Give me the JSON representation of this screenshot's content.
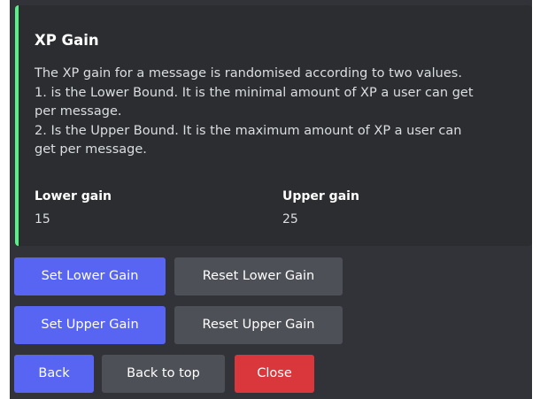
{
  "embed": {
    "accent_color": "#57f287",
    "title": "XP Gain",
    "description_lines": [
      "The XP gain for a message is randomised according to two values.",
      "1. is the Lower Bound. It is the minimal amount of XP a user can get",
      "per message.",
      "2. Is the Upper Bound. It is the maximum amount of XP a user can",
      "get per message."
    ],
    "fields": {
      "lower": {
        "name": "Lower gain",
        "value": "15"
      },
      "upper": {
        "name": "Upper gain",
        "value": "25"
      }
    }
  },
  "buttons": {
    "set_lower": {
      "label": "Set Lower Gain",
      "style": "primary"
    },
    "reset_lower": {
      "label": "Reset Lower Gain",
      "style": "secondary"
    },
    "set_upper": {
      "label": "Set Upper Gain",
      "style": "primary"
    },
    "reset_upper": {
      "label": "Reset Upper Gain",
      "style": "secondary"
    },
    "back": {
      "label": "Back",
      "style": "primary"
    },
    "back_to_top": {
      "label": "Back to top",
      "style": "secondary"
    },
    "close": {
      "label": "Close",
      "style": "danger"
    }
  },
  "colors": {
    "primary": "#5865f2",
    "secondary": "#4e5058",
    "danger": "#da373c",
    "background": "#313338",
    "embed_background": "#2b2d31"
  }
}
